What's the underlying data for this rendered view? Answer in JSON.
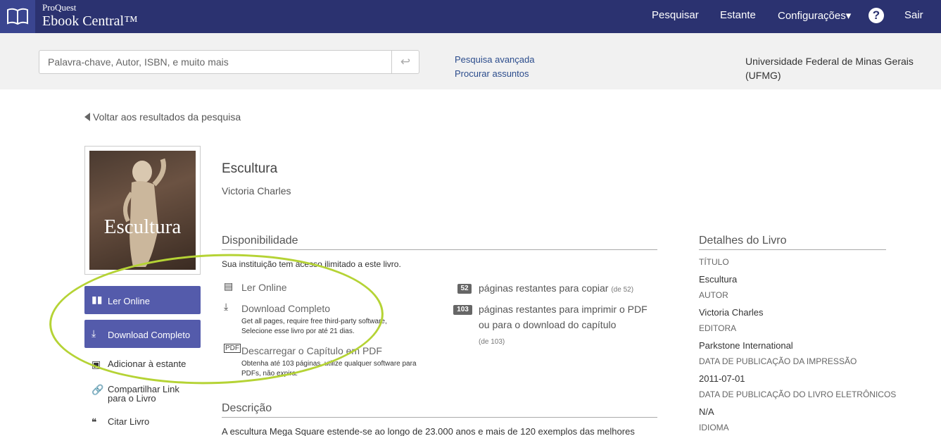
{
  "header": {
    "brand_small": "ProQuest",
    "brand_big": "Ebook Central™",
    "nav": [
      "Pesquisar",
      "Estante",
      "Configurações▾",
      "Sair"
    ],
    "help_glyph": "?"
  },
  "search": {
    "placeholder": "Palavra-chave, Autor, ISBN, e muito mais",
    "submit_glyph": "↩",
    "advanced": "Pesquisa avançada",
    "browse": "Procurar assuntos",
    "institution": "Universidade Federal de Minas Gerais (UFMG)"
  },
  "back_link": "Voltar aos resultados da pesquisa",
  "cover": {
    "title": "Escultura"
  },
  "actions": {
    "read_online": "Ler Online",
    "download_full": "Download Completo",
    "add_shelf": "Adicionar à estante",
    "share_link": "Compartilhar Link para o Livro",
    "cite": "Citar Livro"
  },
  "book": {
    "title": "Escultura",
    "author": "Victoria Charles"
  },
  "availability": {
    "heading": "Disponibilidade",
    "note": "Sua instituição tem acesso ilimitado a este livro.",
    "read_online": "Ler Online",
    "download_full": "Download Completo",
    "download_desc": "Get all pages, require free third-party software, Selecione esse livro por até 21 dias.",
    "chapter_pdf": "Descarregar o Capítulo em PDF",
    "chapter_desc": "Obtenha até 103 páginas, utilize qualquer software para PDFs, não expira.",
    "copy_count": "52",
    "copy_text": "páginas restantes para copiar",
    "copy_of": "(de 52)",
    "print_count": "103",
    "print_text": "páginas restantes para imprimir o PDF ou para o download do capítulo",
    "print_of": "(de 103)"
  },
  "description": {
    "heading": "Descrição",
    "text": "A escultura Mega Square estende-se ao longo de 23.000 anos e mais de 120 exemplos das melhores"
  },
  "details": {
    "heading": "Detalhes do Livro",
    "items": [
      {
        "label": "TÍTULO",
        "value": "Escultura"
      },
      {
        "label": "AUTOR",
        "value": "Victoria Charles"
      },
      {
        "label": "EDITORA",
        "value": "Parkstone International"
      },
      {
        "label": "DATA DE PUBLICAÇÃO DA IMPRESSÃO",
        "value": "2011-07-01"
      },
      {
        "label": "DATA DE PUBLICAÇÃO DO LIVRO ELETRÔNICOS",
        "value": "N/A"
      },
      {
        "label": "IDIOMA",
        "value": ""
      }
    ]
  },
  "colors": {
    "nav_bg": "#2b3270",
    "button_bg": "#545bab",
    "highlight": "#b5d335"
  }
}
